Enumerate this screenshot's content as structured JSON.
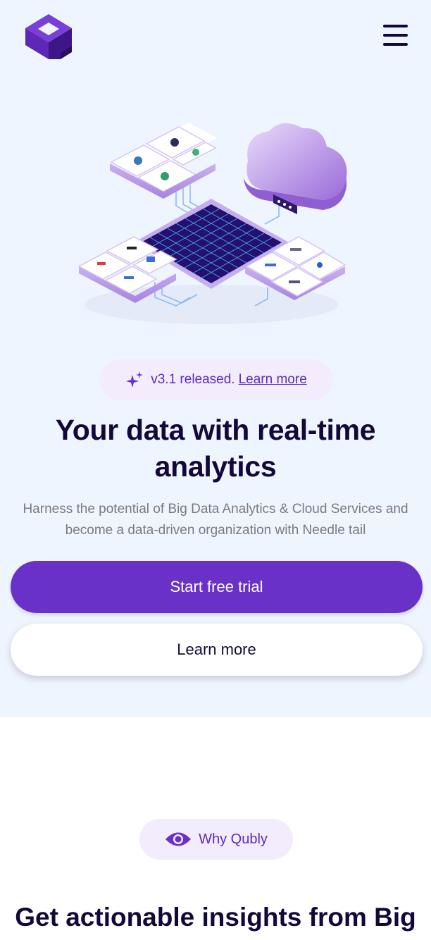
{
  "header": {
    "logo_icon": "qubly-logo-icon",
    "menu_icon": "hamburger-menu-icon"
  },
  "hero": {
    "release_text": "v3.1 released.",
    "release_link": "Learn more",
    "release_icon": "sparkles-icon",
    "title": "Your data with real-time analytics",
    "subtitle": "Harness the potential of Big Data Analytics & Cloud Services and become a data-driven organization with Needle tail",
    "primary_cta": "Start free trial",
    "secondary_cta": "Learn more"
  },
  "why": {
    "badge_label": "Why Qubly",
    "badge_icon": "eye-icon",
    "title": "Get actionable insights from Big"
  },
  "colors": {
    "primary": "#6a31c9",
    "hero_bg": "#eff5fe",
    "heading": "#14083a",
    "pill_bg": "#f3ecfd",
    "pill_text": "#5b2bc0",
    "body_text": "#7a7a7f"
  }
}
